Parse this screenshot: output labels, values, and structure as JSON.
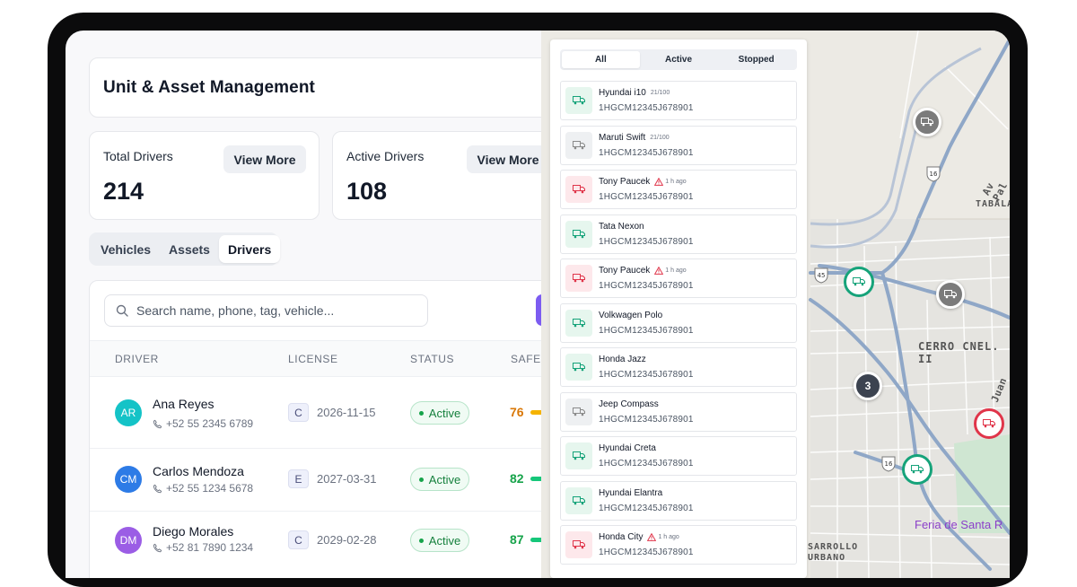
{
  "header": {
    "title": "Unit & Asset Management"
  },
  "stats": [
    {
      "label": "Total Drivers",
      "value": "214",
      "button": "View More"
    },
    {
      "label": "Active Drivers",
      "value": "108",
      "button": "View More"
    }
  ],
  "tabs": [
    {
      "label": "Vehicles",
      "selected": false
    },
    {
      "label": "Assets",
      "selected": false
    },
    {
      "label": "Drivers",
      "selected": true
    }
  ],
  "search": {
    "placeholder": "Search name, phone, tag, vehicle..."
  },
  "table": {
    "columns": [
      "DRIVER",
      "LICENSE",
      "STATUS",
      "SAFET"
    ],
    "rows": [
      {
        "initials": "AR",
        "avatar_color": "#14c3c7",
        "name": "Ana Reyes",
        "phone": "+52 55 2345 6789",
        "license_class": "C",
        "license_exp": "2026-11-15",
        "status": "Active",
        "safety": "76",
        "safety_color": "#d97706",
        "bar_color": "#f5b300"
      },
      {
        "initials": "CM",
        "avatar_color": "#2d7be6",
        "name": "Carlos Mendoza",
        "phone": "+52 55 1234 5678",
        "license_class": "E",
        "license_exp": "2027-03-31",
        "status": "Active",
        "safety": "82",
        "safety_color": "#16a34a",
        "bar_color": "#16c77a"
      },
      {
        "initials": "DM",
        "avatar_color": "#9b5de5",
        "name": "Diego Morales",
        "phone": "+52 81 7890 1234",
        "license_class": "C",
        "license_exp": "2029-02-28",
        "status": "Active",
        "safety": "87",
        "safety_color": "#16a34a",
        "bar_color": "#16c77a"
      }
    ]
  },
  "vehicle_panel": {
    "filters": [
      {
        "label": "All",
        "selected": true
      },
      {
        "label": "Active",
        "selected": false
      },
      {
        "label": "Stopped",
        "selected": false
      }
    ],
    "vehicles": [
      {
        "name": "Hyundai i10",
        "meta": "21/100",
        "warning": false,
        "vin": "1HGCM12345J678901",
        "state": "active"
      },
      {
        "name": "Maruti Swift",
        "meta": "21/100",
        "warning": false,
        "vin": "1HGCM12345J678901",
        "state": "stopped"
      },
      {
        "name": "Tony Paucek",
        "meta": "1 h ago",
        "warning": true,
        "vin": "1HGCM12345J678901",
        "state": "alert"
      },
      {
        "name": "Tata Nexon",
        "meta": "",
        "warning": false,
        "vin": "1HGCM12345J678901",
        "state": "active"
      },
      {
        "name": "Tony Paucek",
        "meta": "1 h ago",
        "warning": true,
        "vin": "1HGCM12345J678901",
        "state": "alert"
      },
      {
        "name": "Volkwagen Polo",
        "meta": "",
        "warning": false,
        "vin": "1HGCM12345J678901",
        "state": "active"
      },
      {
        "name": "Honda Jazz",
        "meta": "",
        "warning": false,
        "vin": "1HGCM12345J678901",
        "state": "active"
      },
      {
        "name": "Jeep Compass",
        "meta": "",
        "warning": false,
        "vin": "1HGCM12345J678901",
        "state": "stopped"
      },
      {
        "name": "Hyundai Creta",
        "meta": "",
        "warning": false,
        "vin": "1HGCM12345J678901",
        "state": "active"
      },
      {
        "name": "Hyundai Elantra",
        "meta": "",
        "warning": false,
        "vin": "1HGCM12345J678901",
        "state": "active"
      },
      {
        "name": "Honda City",
        "meta": "1 h ago",
        "warning": true,
        "vin": "1HGCM12345J678901",
        "state": "alert"
      }
    ]
  },
  "map": {
    "labels": [
      "CERRO CNEL. II",
      "TABALA",
      "Av Pal",
      "Juan",
      "Feria de Santa R",
      "SARROLLO",
      "URBANO"
    ],
    "shields": [
      "16",
      "45",
      "16",
      "16"
    ],
    "cluster_count": "3"
  },
  "colors": {
    "active": "#16a37a",
    "stopped": "#8a8a8a",
    "alert": "#e0354a",
    "accent": "#7c5cf1"
  }
}
